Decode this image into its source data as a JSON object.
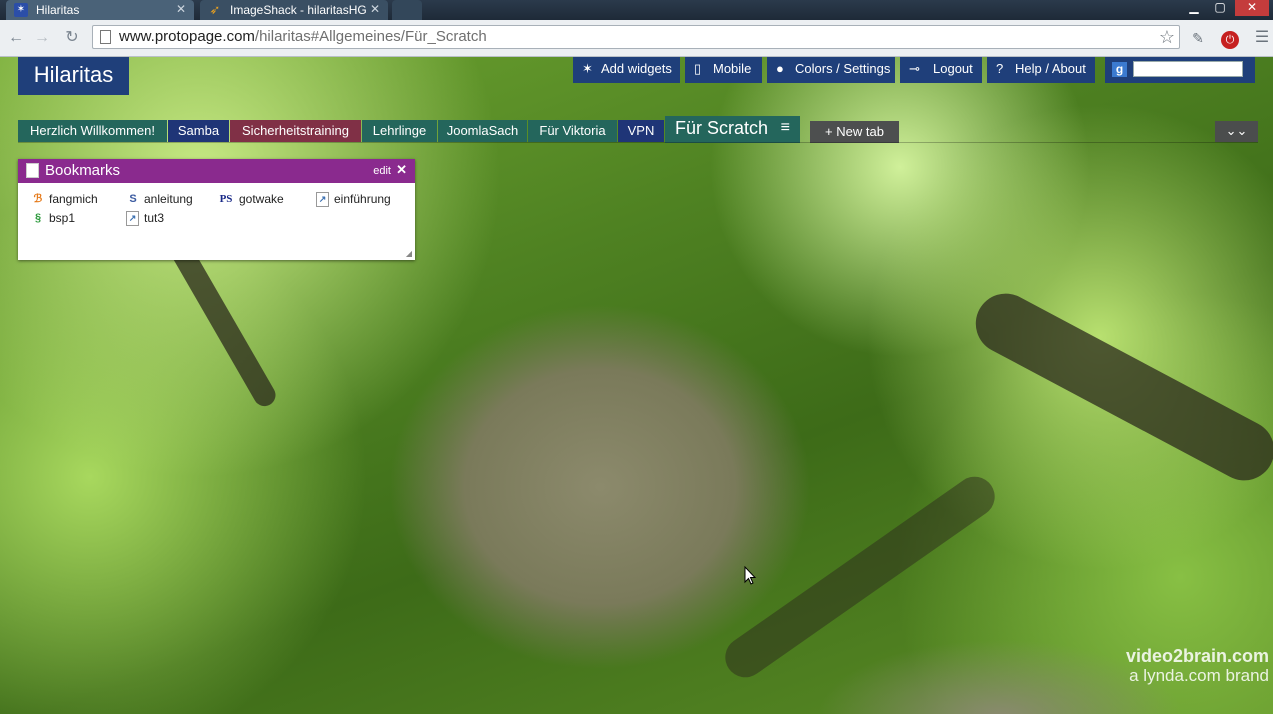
{
  "browser": {
    "tabs": [
      {
        "title": "Hilaritas",
        "favicon": "protopage-favicon",
        "active": true
      },
      {
        "title": "ImageShack - hilaritasHG",
        "favicon": "imageshack-favicon",
        "active": false
      }
    ],
    "url_domain": "www.protopage.com",
    "url_path": "/hilaritas#Allgemeines/Für_Scratch"
  },
  "site": {
    "logo": "Hilaritas",
    "menu": [
      {
        "label": "Add widgets",
        "icon": "sparkle-icon"
      },
      {
        "label": "Mobile",
        "icon": "phone-icon"
      },
      {
        "label": "Colors / Settings",
        "icon": "palette-icon"
      },
      {
        "label": "Logout",
        "icon": "key-icon"
      },
      {
        "label": "Help / About",
        "icon": "question-icon"
      }
    ],
    "search_placeholder": ""
  },
  "page_tabs": [
    {
      "label": "Herzlich Willkommen!",
      "color": "#24665c"
    },
    {
      "label": "Samba",
      "color": "#1f3577"
    },
    {
      "label": "Sicherheitstraining",
      "color": "#803046"
    },
    {
      "label": "Lehrlinge",
      "color": "#24665c"
    },
    {
      "label": "JoomlaSach",
      "color": "#24665c"
    },
    {
      "label": "Für Viktoria",
      "color": "#24665c"
    },
    {
      "label": "VPN",
      "color": "#1f3577"
    }
  ],
  "active_tab": {
    "label": "Für Scratch"
  },
  "new_tab_label": "New tab",
  "widget": {
    "title": "Bookmarks",
    "edit_label": "edit",
    "bookmarks": [
      {
        "label": "fangmich",
        "icon": "blogger-icon"
      },
      {
        "label": "anleitung",
        "icon": "scratch-icon"
      },
      {
        "label": "gotwake",
        "icon": "ps-icon"
      },
      {
        "label": "einführung",
        "icon": "page-icon"
      },
      {
        "label": "bsp1",
        "icon": "green-s-icon"
      },
      {
        "label": "tut3",
        "icon": "page-icon"
      }
    ]
  },
  "watermark": {
    "line1": "video2brain.com",
    "line2": "a lynda.com brand"
  }
}
